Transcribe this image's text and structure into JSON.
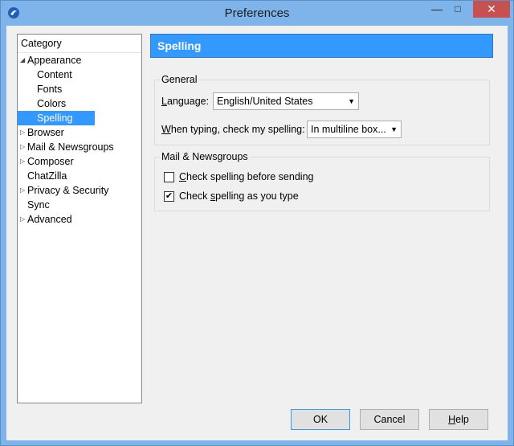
{
  "window": {
    "title": "Preferences"
  },
  "tree": {
    "header": "Category",
    "items": [
      {
        "label": "Appearance",
        "level": 0,
        "twisty": "expanded"
      },
      {
        "label": "Content",
        "level": 1
      },
      {
        "label": "Fonts",
        "level": 1
      },
      {
        "label": "Colors",
        "level": 1
      },
      {
        "label": "Spelling",
        "level": 1,
        "selected": true
      },
      {
        "label": "Browser",
        "level": 0,
        "twisty": "collapsed"
      },
      {
        "label": "Mail & Newsgroups",
        "level": 0,
        "twisty": "collapsed"
      },
      {
        "label": "Composer",
        "level": 0,
        "twisty": "collapsed"
      },
      {
        "label": "ChatZilla",
        "level": 0
      },
      {
        "label": "Privacy & Security",
        "level": 0,
        "twisty": "collapsed"
      },
      {
        "label": "Sync",
        "level": 0
      },
      {
        "label": "Advanced",
        "level": 0,
        "twisty": "collapsed"
      }
    ]
  },
  "panel": {
    "title": "Spelling",
    "general": {
      "legend": "General",
      "language_label": "Language:",
      "language_value": "English/United States",
      "typing_label": "When typing, check my spelling:",
      "typing_value": "In multiline box..."
    },
    "mail": {
      "legend": "Mail & Newsgroups",
      "check_before_label": "Check spelling before sending",
      "check_before_checked": false,
      "check_as_type_label": "Check spelling as you type",
      "check_as_type_checked": true
    }
  },
  "buttons": {
    "ok": "OK",
    "cancel": "Cancel",
    "help": "Help"
  },
  "colors": {
    "accent": "#3399ff",
    "titlebar": "#7eb4ea",
    "close": "#c75050"
  }
}
